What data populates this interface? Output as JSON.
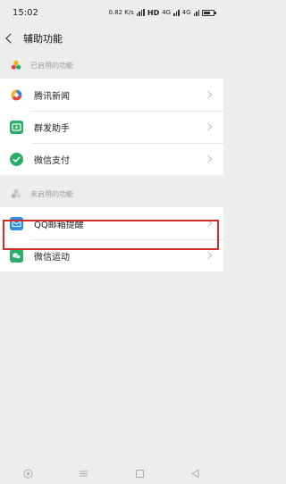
{
  "status_bar": {
    "time": "15:02",
    "net_speed": "0.82 K/s",
    "hd_label": "HD",
    "network_1": "4G",
    "network_2": "4G",
    "battery_level": 0.7
  },
  "nav": {
    "title": "辅助功能",
    "back_icon": "chevron-left-icon"
  },
  "sections": [
    {
      "header": "已启用的功能",
      "icon": "three-dots-cluster-icon"
    },
    {
      "header": "未启用的功能",
      "icon": "three-dots-cluster-gray-icon"
    }
  ],
  "enabled_items": [
    {
      "label": "腾讯新闻",
      "icon": "tencent-news-icon",
      "color": "#ffffff"
    },
    {
      "label": "群发助手",
      "icon": "broadcast-icon",
      "color": "#2aae67"
    },
    {
      "label": "微信支付",
      "icon": "wechat-pay-icon",
      "color": "#2aae67"
    }
  ],
  "disabled_items": [
    {
      "label": "QQ邮箱提醒",
      "icon": "mail-icon",
      "color": "#2f8de4"
    },
    {
      "label": "微信运动",
      "icon": "wechat-sport-icon",
      "color": "#2aae67",
      "highlighted": true
    }
  ],
  "bottom_nav": [
    "assistant-icon",
    "menu-icon",
    "home-square-icon",
    "back-triangle-icon"
  ],
  "colors": {
    "highlight": "#d62a2a",
    "accent": "#2aae67",
    "background": "#ededed"
  }
}
